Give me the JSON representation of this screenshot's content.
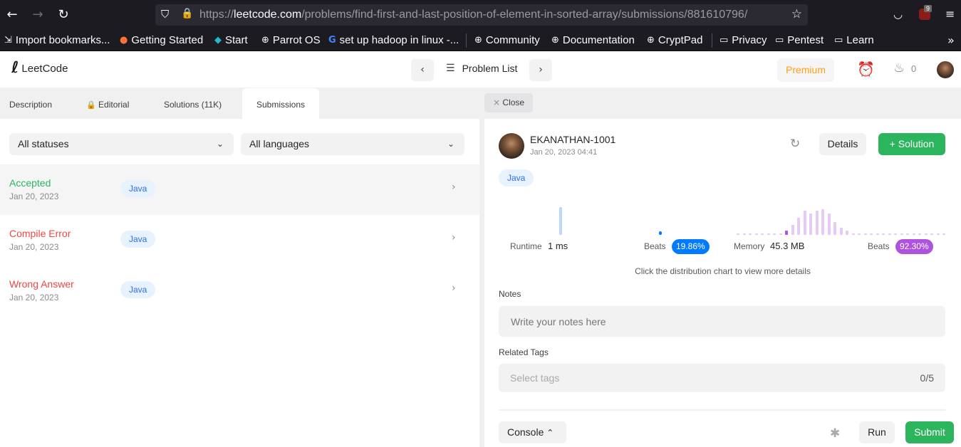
{
  "browser": {
    "url_prefix": "https://",
    "url_domain": "leetcode.com",
    "url_path": "/problems/find-first-and-last-position-of-element-in-sorted-array/submissions/881610796/",
    "extension_badge": "9",
    "bookmarks": [
      {
        "label": "Import bookmarks...",
        "icon": "import-icon"
      },
      {
        "label": "Getting Started",
        "icon": "firefox-icon"
      },
      {
        "label": "Start",
        "icon": "parrot-icon"
      },
      {
        "label": "Parrot OS",
        "icon": "globe-icon"
      },
      {
        "label": "set up hadoop in linux -...",
        "icon": "google-icon"
      },
      {
        "label": "Community",
        "icon": "globe-icon"
      },
      {
        "label": "Documentation",
        "icon": "globe-icon"
      },
      {
        "label": "CryptPad",
        "icon": "globe-icon"
      },
      {
        "label": "Privacy",
        "icon": "folder-icon"
      },
      {
        "label": "Pentest",
        "icon": "folder-icon"
      },
      {
        "label": "Learn",
        "icon": "folder-icon"
      }
    ]
  },
  "header": {
    "logo_text": "LeetCode",
    "problem_list_label": "Problem List",
    "premium_label": "Premium",
    "streak_count": "0"
  },
  "left": {
    "tabs": [
      {
        "label": "Description"
      },
      {
        "label": "Editorial"
      },
      {
        "label": "Solutions (11K)"
      },
      {
        "label": "Submissions"
      }
    ],
    "status_filter": "All statuses",
    "language_filter": "All languages",
    "submissions": [
      {
        "status": "Accepted",
        "date": "Jan 20, 2023",
        "lang": "Java",
        "color": "#2db55d"
      },
      {
        "status": "Compile Error",
        "date": "Jan 20, 2023",
        "lang": "Java",
        "color": "#ef4743"
      },
      {
        "status": "Wrong Answer",
        "date": "Jan 20, 2023",
        "lang": "Java",
        "color": "#ef4743"
      }
    ]
  },
  "right": {
    "close_label": "Close",
    "user": {
      "name": "EKANATHAN-1001",
      "date": "Jan 20, 2023 04:41"
    },
    "details_label": "Details",
    "solution_label": "Solution",
    "lang": "Java",
    "runtime": {
      "label": "Runtime",
      "value": "1 ms",
      "beats_label": "Beats",
      "beats": "19.86%"
    },
    "memory": {
      "label": "Memory",
      "value": "45.3 MB",
      "beats_label": "Beats",
      "beats": "92.30%"
    },
    "hint": "Click the distribution chart to view more details",
    "notes_label": "Notes",
    "notes_placeholder": "Write your notes here",
    "tags_label": "Related Tags",
    "tags_placeholder": "Select tags",
    "tags_count": "0/5",
    "console_label": "Console",
    "run_label": "Run",
    "submit_label": "Submit"
  },
  "colors": {
    "accent_green": "#2db55d",
    "error_red": "#ef4743",
    "premium_orange": "#ffa116",
    "runtime_blue": "#007aff",
    "memory_purple": "#af52de"
  }
}
